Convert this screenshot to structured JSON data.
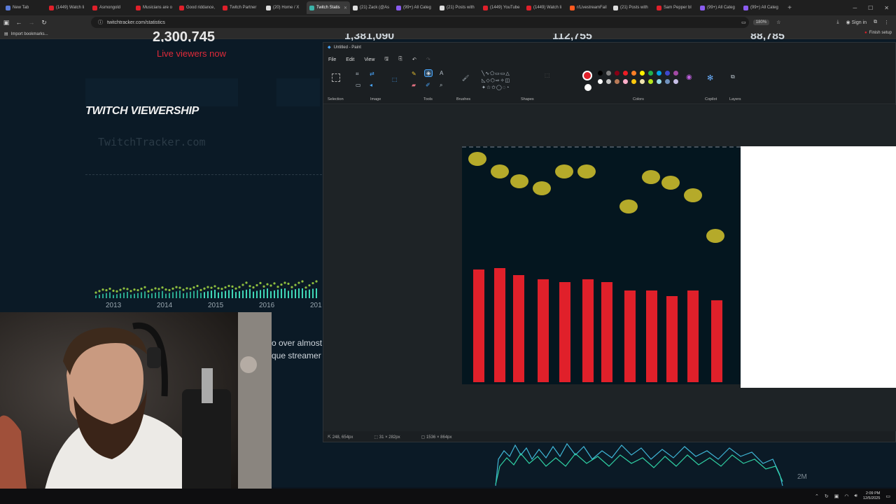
{
  "browser": {
    "tabs": [
      {
        "title": "New Tab",
        "color": "#5a7bd8"
      },
      {
        "title": "(1449) Watch li",
        "color": "#e0202a"
      },
      {
        "title": "Asmongold",
        "color": "#e0202a"
      },
      {
        "title": "Musicians are o",
        "color": "#e0202a"
      },
      {
        "title": "Good riddance,",
        "color": "#e0202a"
      },
      {
        "title": "Twitch Partner",
        "color": "#e0202a"
      },
      {
        "title": "(20) Home / X",
        "color": "#dddddd"
      },
      {
        "title": "Twitch Statis",
        "color": "#3bb3a8",
        "active": true
      },
      {
        "title": "(21) Zack (@As",
        "color": "#dddddd"
      },
      {
        "title": "(99+) All Categ",
        "color": "#8a5cf0"
      },
      {
        "title": "(21) Posts with",
        "color": "#dddddd"
      },
      {
        "title": "(1449) YouTube",
        "color": "#e0202a"
      },
      {
        "title": "(1449) Watch li",
        "color": "#e0202a"
      },
      {
        "title": "r/LivestreamFail",
        "color": "#ff5a1f"
      },
      {
        "title": "(21) Posts with",
        "color": "#dddddd"
      },
      {
        "title": "Sam Pepper bl",
        "color": "#e0202a"
      },
      {
        "title": "(99+) All Categ",
        "color": "#8a5cf0"
      },
      {
        "title": "(99+) All Categ",
        "color": "#8a5cf0"
      }
    ],
    "new_tab": "+",
    "tab_close": "✕",
    "address": "twitchtracker.com/statistics",
    "zoom": "180%",
    "sign_in": "Sign in",
    "bookmarks_label": "Import bookmarks...",
    "finish_setup": "Finish setup",
    "window_controls": [
      "─",
      "☐",
      "✕"
    ]
  },
  "site": {
    "live_count": "2,300,745",
    "live_label": "Live viewers now",
    "stat2": "1,381,090",
    "stat3": "112,755",
    "stat4": "88,785",
    "viewership_title": "TWITCH VIEWERSHIP",
    "watermark": "TwitchTracker.com",
    "years": [
      "2013",
      "2014",
      "2015",
      "2016",
      "201"
    ],
    "text_line1": "o over almost",
    "text_line2": "que streamer",
    "label_2m": "2M"
  },
  "paint": {
    "title": "Untitled - Paint",
    "menu": [
      "File",
      "Edit",
      "View"
    ],
    "groups": [
      "Selection",
      "Image",
      "Tools",
      "Brushes",
      "Shapes",
      "Colors",
      "Copilot",
      "Layers"
    ],
    "status": {
      "cursor": "248, 654px",
      "selection": "31 × 282px",
      "canvas": "1536 × 864px"
    },
    "palette": [
      "#000000",
      "#7f7f7f",
      "#880015",
      "#ed1c24",
      "#ff7f27",
      "#fff200",
      "#22b14c",
      "#00a2e8",
      "#3f48cc",
      "#a349a4",
      "#ffffff",
      "#c3c3c3",
      "#b97a57",
      "#ffaec9",
      "#ffc90e",
      "#efe4b0",
      "#b5e61d",
      "#99d9ea",
      "#7092be",
      "#c8bfe7"
    ],
    "primary_color": "#e0202a",
    "secondary_color": "#ffffff"
  },
  "taskbar": {
    "time": "2:09 PM",
    "date": "12/5/2025"
  }
}
